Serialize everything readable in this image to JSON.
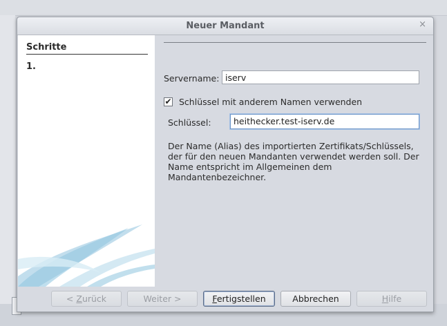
{
  "dialog": {
    "title": "Neuer Mandant",
    "close_glyph": "×"
  },
  "steps": {
    "heading": "Schritte",
    "items": [
      "1."
    ]
  },
  "form": {
    "servername_label": "Servername:",
    "servername_value": "iserv",
    "checkbox_checked": true,
    "checkbox_glyph": "✔",
    "checkbox_label": "Schlüssel mit anderem Namen verwenden",
    "key_label": "Schlüssel:",
    "key_value": "heithecker.test-iserv.de",
    "description": "Der Name (Alias) des importierten Zertifikats/Schlüssels, der für den neuen Mandanten verwendet werden soll. Der Name entspricht im Allgemeinen dem Mandantenbezeichner."
  },
  "buttons": {
    "back": {
      "prefix": "< ",
      "mnemonic": "Z",
      "rest": "urück",
      "enabled": false
    },
    "next": {
      "label": "Weiter >",
      "enabled": false
    },
    "finish": {
      "mnemonic": "F",
      "rest": "ertigstellen",
      "enabled": true
    },
    "cancel": {
      "label": "Abbrechen",
      "enabled": true
    },
    "help": {
      "mnemonic": "H",
      "rest": "ilfe",
      "enabled": false
    }
  },
  "colors": {
    "dialog_bg": "#d7dae1",
    "focus_border": "#6d95c8",
    "swoosh": "#8fc3de"
  }
}
